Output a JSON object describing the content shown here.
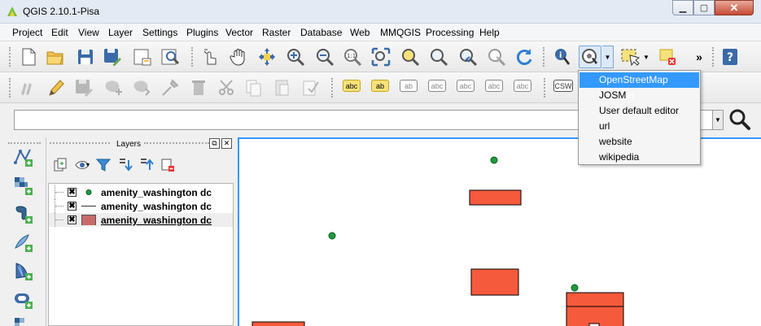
{
  "window": {
    "title": "QGIS 2.10.1-Pisa"
  },
  "menu": [
    "Project",
    "Edit",
    "View",
    "Layer",
    "Settings",
    "Plugins",
    "Vector",
    "Raster",
    "Database",
    "Web",
    "MMQGIS",
    "Processing",
    "Help"
  ],
  "labeling_toolbar": [
    "abc",
    "ab",
    "ab",
    "abc",
    "abc",
    "abc",
    "abc"
  ],
  "csw_label": "CSW",
  "address_bar": {
    "value": ""
  },
  "layers_panel": {
    "title": "Layers",
    "layers": [
      {
        "name": "amenity_washington dc",
        "geometry": "point",
        "symbol_color": "#1e9a3c",
        "checked": "✖"
      },
      {
        "name": "amenity_washington dc",
        "geometry": "line",
        "symbol_color": "#333333",
        "checked": "✖"
      },
      {
        "name": "amenity_washington dc",
        "geometry": "polygon",
        "symbol_color": "#c96a6a",
        "checked": "✖"
      }
    ]
  },
  "osm_dropdown": {
    "items": [
      "OpenStreetMap Browser",
      "JOSM",
      "User default editor",
      "url",
      "website",
      "wikipedia"
    ],
    "selected": "OpenStreetMap Browser"
  },
  "map": {
    "fill_color": "#f55a3c",
    "point_color": "#1e9a3c"
  },
  "icons": {
    "more": "»",
    "help": "?"
  }
}
